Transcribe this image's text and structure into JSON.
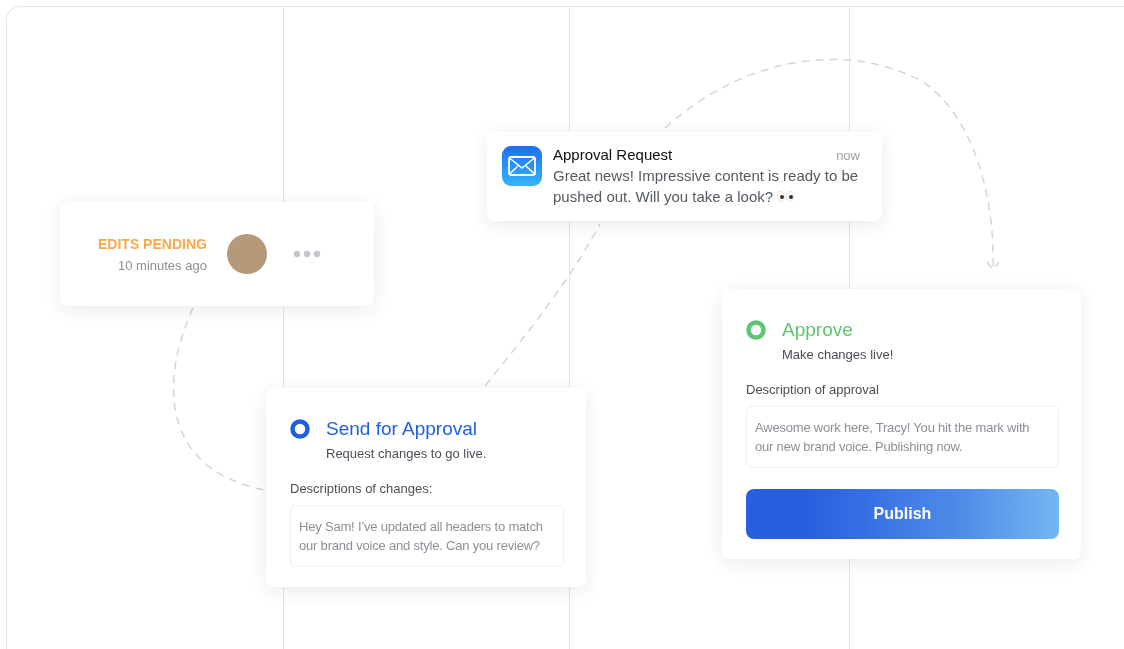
{
  "pending": {
    "status": "EDITS PENDING",
    "time": "10 minutes ago"
  },
  "notification": {
    "title": "Approval Request",
    "time": "now",
    "message": "Great news! Impressive content is ready to be pushed out. Will you take a look?"
  },
  "options": [
    {
      "title": "Send for Approval",
      "subtitle": "Request changes to go live.",
      "field_label": "Descriptions of changes:",
      "value": "Hey Sam! I’ve updated all headers to match our brand voice and style. Can you review?",
      "color": "#1f5fe0"
    },
    {
      "title": "Approve",
      "subtitle": "Make changes live!",
      "field_label": "Description of approval",
      "value": "Awesome work here, Tracy! You hit the mark with our new brand voice. Publishing now.",
      "color": "#5cc670",
      "button": "Publish"
    }
  ]
}
